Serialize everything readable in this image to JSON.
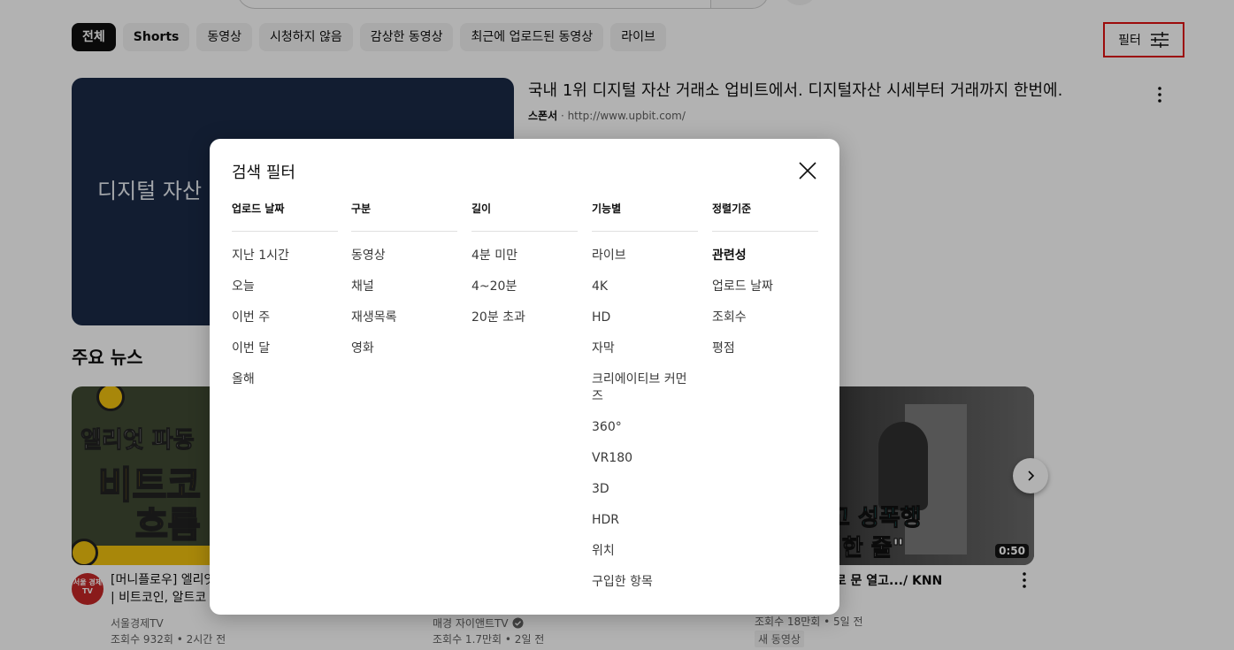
{
  "chips": [
    {
      "label": "전체"
    },
    {
      "label": "Shorts"
    },
    {
      "label": "동영상"
    },
    {
      "label": "시청하지 않음"
    },
    {
      "label": "감상한 동영상"
    },
    {
      "label": "최근에 업로드된 동영상"
    },
    {
      "label": "라이브"
    }
  ],
  "filter_button": {
    "label": "필터"
  },
  "ad": {
    "thumbnail_text": "디지털 자산",
    "title": "국내 1위 디지털 자산 거래소 업비트에서. 디지털자산 시세부터 거래까지 한번에.",
    "sponsor_label": "스폰서",
    "url": "http://www.upbit.com/"
  },
  "news": {
    "section_title": "주요 뉴스",
    "cards": [
      {
        "thumb_line1": "엘리엇 파동",
        "thumb_line2": "비트코",
        "thumb_line3": "흐름",
        "avatar_text": "서울 경제 TV",
        "title_line1": "[머니플로우] 엘리엇",
        "title_line2": "| 비트코인, 알트코",
        "channel": "서울경제TV",
        "meta": "조회수 932회 • 2시간 전"
      },
      {
        "channel": "매경 자이앤트TV",
        "meta": "조회수 1.7만회 • 2일 전"
      },
      {
        "thumb_line1": "로 문 열고 성폭행",
        "thumb_line2": "않아 동의한 줄\"",
        "duration": "0:50",
        "title": "터키로 문 열고.../ KNN",
        "meta": "조회수 18만회 • 5일 전",
        "badge": "새 동영상"
      }
    ]
  },
  "dialog": {
    "title": "검색 필터",
    "columns": [
      {
        "header": "업로드 날짜",
        "items": [
          "지난 1시간",
          "오늘",
          "이번 주",
          "이번 달",
          "올해"
        ]
      },
      {
        "header": "구분",
        "items": [
          "동영상",
          "채널",
          "재생목록",
          "영화"
        ]
      },
      {
        "header": "길이",
        "items": [
          "4분 미만",
          "4~20분",
          "20분 초과"
        ]
      },
      {
        "header": "기능별",
        "items": [
          "라이브",
          "4K",
          "HD",
          "자막",
          "크리에이티브 커먼즈",
          "360°",
          "VR180",
          "3D",
          "HDR",
          "위치",
          "구입한 항목"
        ]
      },
      {
        "header": "정렬기준",
        "items": [
          "관련성",
          "업로드 날짜",
          "조회수",
          "평점"
        ]
      }
    ]
  }
}
